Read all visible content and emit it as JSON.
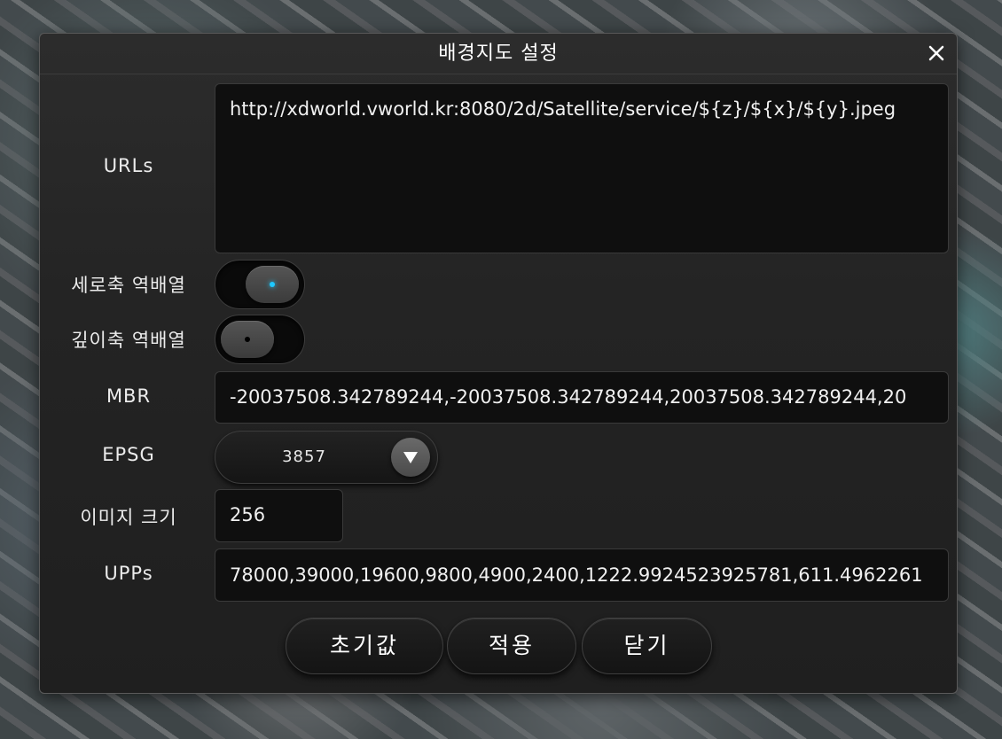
{
  "dialog": {
    "title": "배경지도 설정",
    "close_icon": "close-icon"
  },
  "fields": {
    "urls": {
      "label": "URLs",
      "value": "http://xdworld.vworld.kr:8080/2d/Satellite/service/${z}/${x}/${y}.jpeg"
    },
    "invert_y": {
      "label": "세로축 역배열",
      "enabled": true,
      "indicator_color": "#1ec8ff"
    },
    "invert_z": {
      "label": "깊이축 역배열",
      "enabled": false,
      "indicator_color": "#000000"
    },
    "mbr": {
      "label": "MBR",
      "value": "-20037508.342789244,-20037508.342789244,20037508.342789244,20"
    },
    "epsg": {
      "label": "EPSG",
      "value": "3857",
      "arrow_icon": "triangle-down-icon"
    },
    "image_size": {
      "label": "이미지 크기",
      "value": "256"
    },
    "upps": {
      "label": "UPPs",
      "value": "78000,39000,19600,9800,4900,2400,1222.9924523925781,611.4962261"
    }
  },
  "buttons": {
    "reset": "초기값",
    "apply": "적용",
    "close": "닫기"
  }
}
